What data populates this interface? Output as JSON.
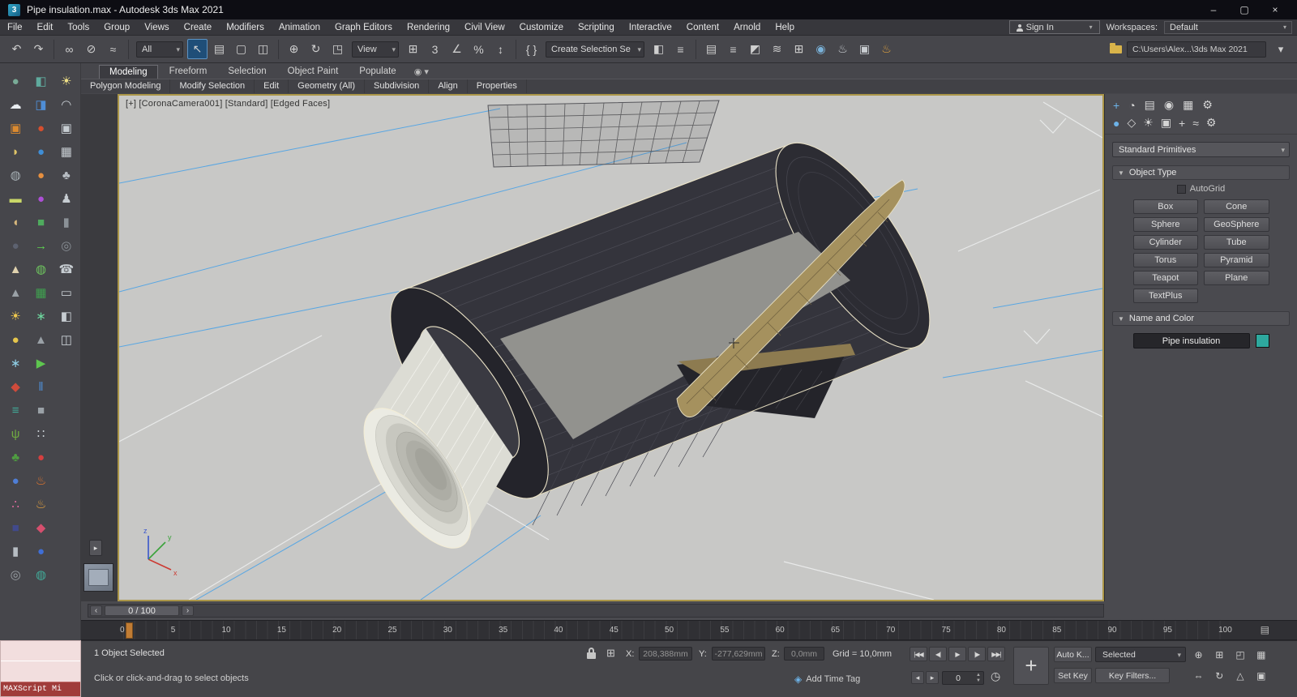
{
  "colors": {
    "object_color": "#2ea89e",
    "ruler_handle": "#c07c34",
    "viewport_bg": "#c8c8c6",
    "selection_outline": "#ece4c8"
  },
  "titlebar": {
    "logo": "3",
    "title": "Pipe insulation.max - Autodesk 3ds Max 2021",
    "minimize": "–",
    "maximize": "▢",
    "close": "×"
  },
  "menubar": {
    "items": [
      "File",
      "Edit",
      "Tools",
      "Group",
      "Views",
      "Create",
      "Modifiers",
      "Animation",
      "Graph Editors",
      "Rendering",
      "Civil View",
      "Customize",
      "Scripting",
      "Interactive",
      "Content",
      "Arnold",
      "Help"
    ],
    "signin": "Sign In",
    "workspaces_label": "Workspaces:",
    "workspace": "Default"
  },
  "toolbar": {
    "items": [
      {
        "cls": "tb-icon",
        "n": "undo-icon",
        "g": "↶"
      },
      {
        "cls": "tb-icon",
        "n": "redo-icon",
        "g": "↷"
      },
      {
        "cls": "tb-sep",
        "n": "toolbar-separator",
        "g": ""
      },
      {
        "cls": "tb-icon",
        "n": "select-link-icon",
        "g": "∞"
      },
      {
        "cls": "tb-icon",
        "n": "unlink-icon",
        "g": "⊘"
      },
      {
        "cls": "tb-icon",
        "n": "bind-spacewarp-icon",
        "g": "≈"
      },
      {
        "cls": "tb-sep",
        "n": "toolbar-separator",
        "g": ""
      },
      {
        "cls": "tb-dd",
        "n": "selection-filter-dropdown",
        "g": "All"
      },
      {
        "cls": "tb-icon active",
        "n": "select-object-icon",
        "g": "↖"
      },
      {
        "cls": "tb-icon",
        "n": "select-by-name-icon",
        "g": "▤"
      },
      {
        "cls": "tb-icon",
        "n": "rect-selection-icon",
        "g": "▢"
      },
      {
        "cls": "tb-icon",
        "n": "window-crossing-icon",
        "g": "◫"
      },
      {
        "cls": "tb-sep",
        "n": "toolbar-separator",
        "g": ""
      },
      {
        "cls": "tb-icon",
        "n": "select-move-icon",
        "g": "⊕"
      },
      {
        "cls": "tb-icon",
        "n": "select-rotate-icon",
        "g": "↻"
      },
      {
        "cls": "tb-icon",
        "n": "select-scale-icon",
        "g": "◳"
      },
      {
        "cls": "tb-dd",
        "n": "ref-coord-dropdown",
        "g": "View"
      },
      {
        "cls": "tb-icon",
        "n": "use-pivot-center-icon",
        "g": "⊞"
      },
      {
        "cls": "tb-icon",
        "n": "snap-3d-icon",
        "g": "3"
      },
      {
        "cls": "tb-icon",
        "n": "angle-snap-icon",
        "g": "∠"
      },
      {
        "cls": "tb-icon",
        "n": "percent-snap-icon",
        "g": "%"
      },
      {
        "cls": "tb-icon",
        "n": "spinner-snap-icon",
        "g": "↕"
      },
      {
        "cls": "tb-sep",
        "n": "toolbar-separator",
        "g": ""
      },
      {
        "cls": "tb-icon",
        "n": "edit-named-selection-icon",
        "g": "{ }"
      },
      {
        "cls": "tb-dd tb-dd-wide",
        "n": "named-selection-dropdown",
        "g": "Create Selection Se"
      },
      {
        "cls": "tb-icon",
        "n": "mirror-icon",
        "g": "◧"
      },
      {
        "cls": "tb-icon",
        "n": "align-icon",
        "g": "≡"
      },
      {
        "cls": "tb-sep",
        "n": "toolbar-separator",
        "g": ""
      },
      {
        "cls": "tb-icon",
        "n": "scene-explorer-icon",
        "g": "▤"
      },
      {
        "cls": "tb-icon",
        "n": "layer-manager-icon",
        "g": "≡"
      },
      {
        "cls": "tb-icon",
        "n": "ribbon-toggle-icon",
        "g": "◩"
      },
      {
        "cls": "tb-icon",
        "n": "curve-editor-icon",
        "g": "≋"
      },
      {
        "cls": "tb-icon",
        "n": "schematic-view-icon",
        "g": "⊞"
      },
      {
        "cls": "tb-icon",
        "n": "material-editor-icon",
        "g": "◉",
        "c": "#7ab2d9"
      },
      {
        "cls": "tb-icon",
        "n": "render-setup-icon",
        "g": "♨",
        "c": "#c9cdd1"
      },
      {
        "cls": "tb-icon",
        "n": "rendered-frame-icon",
        "g": "▣",
        "c": "#c9cdd1"
      },
      {
        "cls": "tb-icon",
        "n": "render-production-icon",
        "g": "♨",
        "c": "#e0a23f"
      }
    ],
    "path": "C:\\Users\\Alex...\\3ds Max 2021",
    "path_extra": "▾"
  },
  "ribbon": {
    "tabs": [
      {
        "label": "Modeling",
        "cls": "active"
      },
      {
        "label": "Freeform"
      },
      {
        "label": "Selection"
      },
      {
        "label": "Object Paint"
      },
      {
        "label": "Populate"
      }
    ],
    "extra": "◉ ▾",
    "groups": [
      "Polygon Modeling",
      "Modify Selection",
      "Edit",
      "Geometry (All)",
      "Subdivision",
      "Align",
      "Properties"
    ]
  },
  "left_tools": {
    "col1": [
      {
        "n": "sphere-tool-icon",
        "g": "●",
        "c": "#79ab97"
      },
      {
        "n": "cloud-tool-icon",
        "g": "☁",
        "c": "#e9edf1"
      },
      {
        "n": "image-frame-icon",
        "g": "▣",
        "c": "#db8a2f"
      },
      {
        "n": "putty-tool-icon",
        "g": "◗",
        "c": "#dfc468"
      },
      {
        "n": "spray-tool-icon",
        "g": "◍",
        "c": "#a7b0b5"
      },
      {
        "n": "plane-tool-icon",
        "g": "▬",
        "c": "#c9d768"
      },
      {
        "n": "bun-tool-icon",
        "g": "◖",
        "c": "#d7b77c"
      },
      {
        "n": "dark-sphere-icon",
        "g": "●",
        "c": "#5d6270"
      },
      {
        "n": "cake-tool-icon",
        "g": "▲",
        "c": "#e0d2ae"
      },
      {
        "n": "cone-tool-icon",
        "g": "▲",
        "c": "#9aa1a7"
      },
      {
        "n": "sun-icon",
        "g": "☀",
        "c": "#f0c94e"
      },
      {
        "n": "yellow-sphere-icon",
        "g": "●",
        "c": "#e6c64c"
      },
      {
        "n": "snowflake-icon",
        "g": "∗",
        "c": "#8fcfe6"
      },
      {
        "n": "droplet-icon",
        "g": "◆",
        "c": "#cf4b3b"
      },
      {
        "n": "ladder-icon",
        "g": "≡",
        "c": "#41ab99"
      },
      {
        "n": "grass-icon",
        "g": "ψ",
        "c": "#70ab41"
      },
      {
        "n": "foliage-icon",
        "g": "♣",
        "c": "#4f9c41"
      },
      {
        "n": "blue-sphere-icon",
        "g": "●",
        "c": "#4f7ed6"
      },
      {
        "n": "berries-icon",
        "g": "∴",
        "c": "#df6a9e"
      },
      {
        "n": "box-tool-icon",
        "g": "■",
        "c": "#414a8c"
      },
      {
        "n": "cylinder-tool-icon",
        "g": "▮",
        "c": "#b7bdc3"
      },
      {
        "n": "spiral-tool-icon",
        "g": "◎",
        "c": "#9aa0a5"
      }
    ],
    "col2": [
      {
        "n": "cube-teal-icon",
        "g": "◧",
        "c": "#5fab9e"
      },
      {
        "n": "cube-blue-icon",
        "g": "◨",
        "c": "#4f8ed6"
      },
      {
        "n": "fire-sphere-icon",
        "g": "●",
        "c": "#d64f2e"
      },
      {
        "n": "water-sphere-icon",
        "g": "●",
        "c": "#3f8ed6"
      },
      {
        "n": "orange-sphere-icon",
        "g": "●",
        "c": "#e68f3f"
      },
      {
        "n": "purple-sphere-icon",
        "g": "●",
        "c": "#ad4fd6"
      },
      {
        "n": "green-cube-icon",
        "g": "■",
        "c": "#4fab5e"
      },
      {
        "n": "arrow-tool-icon",
        "g": "→",
        "c": "#5ed64f"
      },
      {
        "n": "pattern-sphere-icon",
        "g": "◍",
        "c": "#6ec65e"
      },
      {
        "n": "checker-tool-icon",
        "g": "▦",
        "c": "#3fa14f"
      },
      {
        "n": "starburst-icon",
        "g": "∗",
        "c": "#6ed69e"
      },
      {
        "n": "gray-cone-icon",
        "g": "▲",
        "c": "#9aa1a7"
      },
      {
        "n": "play-shape-icon",
        "g": "▶",
        "c": "#5ec64f"
      },
      {
        "n": "pause-shape-icon",
        "g": "‖",
        "c": "#4f8ed6"
      },
      {
        "n": "stop-shape-icon",
        "g": "■",
        "c": "#9aa1a7"
      },
      {
        "n": "dots-tool-icon",
        "g": "∷",
        "c": "#c6ccd1"
      },
      {
        "n": "red-sphere-icon",
        "g": "●",
        "c": "#d63f3f"
      },
      {
        "n": "flame-icon",
        "g": "♨",
        "c": "#e6772e"
      },
      {
        "n": "torch-icon",
        "g": "♨",
        "c": "#e6a13f"
      },
      {
        "n": "paint-icon",
        "g": "◆",
        "c": "#d64f6e"
      },
      {
        "n": "ocean-sphere-icon",
        "g": "●",
        "c": "#3f6ed6"
      },
      {
        "n": "globe-icon",
        "g": "◍",
        "c": "#41ab99"
      }
    ],
    "col3": [
      {
        "n": "lightbulb-icon",
        "g": "☀",
        "c": "#efe087"
      },
      {
        "n": "dome-icon",
        "g": "◠",
        "c": "#c6ccd1"
      },
      {
        "n": "camera-icon",
        "g": "▣",
        "c": "#c6ccd1"
      },
      {
        "n": "photo-icon",
        "g": "▦",
        "c": "#c6ccd1"
      },
      {
        "n": "tree-icon",
        "g": "♣",
        "c": "#b7bdc3"
      },
      {
        "n": "person-icon",
        "g": "♟",
        "c": "#c6ccd1"
      },
      {
        "n": "cylinder-icon",
        "g": "▮",
        "c": "#8b9197"
      },
      {
        "n": "torus-icon",
        "g": "◎",
        "c": "#8b9197"
      },
      {
        "n": "phone-icon",
        "g": "☎",
        "c": "#c6ccd1"
      },
      {
        "n": "monitor-icon",
        "g": "▭",
        "c": "#c6ccd1"
      },
      {
        "n": "camcorder-icon",
        "g": "◧",
        "c": "#c6ccd1"
      },
      {
        "n": "split-view-icon",
        "g": "◫",
        "c": "#c6ccd1"
      }
    ],
    "flyout_arrow": "▸"
  },
  "viewport": {
    "label": "[+] [CoronaCamera001] [Standard] [Edged Faces]"
  },
  "right_panel": {
    "panel_tabs": [
      {
        "n": "create-tab-icon",
        "g": "+",
        "cls": "active"
      },
      {
        "n": "modify-tab-icon",
        "g": "◔"
      },
      {
        "n": "hierarchy-tab-icon",
        "g": "▤"
      },
      {
        "n": "motion-tab-icon",
        "g": "◉"
      },
      {
        "n": "display-tab-icon",
        "g": "▦"
      },
      {
        "n": "utilities-tab-icon",
        "g": "⚙"
      }
    ],
    "categories": [
      {
        "n": "geometry-category-icon",
        "g": "●",
        "cls": "active"
      },
      {
        "n": "shapes-category-icon",
        "g": "◇"
      },
      {
        "n": "lights-category-icon",
        "g": "☀"
      },
      {
        "n": "cameras-category-icon",
        "g": "▣"
      },
      {
        "n": "helpers-category-icon",
        "g": "+"
      },
      {
        "n": "spacewarps-category-icon",
        "g": "≈"
      },
      {
        "n": "systems-category-icon",
        "g": "⚙"
      }
    ],
    "dropdown": "Standard Primitives",
    "rollout_object_type": "Object Type",
    "autogrid": "AutoGrid",
    "buttons": [
      "Box",
      "Cone",
      "Sphere",
      "GeoSphere",
      "Cylinder",
      "Tube",
      "Torus",
      "Pyramid",
      "Teapot",
      "Plane",
      "TextPlus"
    ],
    "rollout_name_color": "Name and Color",
    "object_name": "Pipe insulation",
    "object_color": "#2ea89e"
  },
  "timeline": {
    "prev": "‹",
    "range": "0 / 100",
    "next": "›"
  },
  "ruler": {
    "numbers": [
      "0",
      "5",
      "10",
      "15",
      "20",
      "25",
      "30",
      "35",
      "40",
      "45",
      "50",
      "55",
      "60",
      "65",
      "70",
      "75",
      "80",
      "85",
      "90",
      "95",
      "100"
    ],
    "end_icon": "▤"
  },
  "statusbar": {
    "selected_info": "1 Object Selected",
    "prompt": "Click or click-and-drag to select objects",
    "abs_toggle": "⊞",
    "x_label": "X:",
    "x_value": "208,388mm",
    "y_label": "Y:",
    "y_value": "-277,629mm",
    "z_label": "Z:",
    "z_value": "0,0mm",
    "grid": "Grid = 10,0mm",
    "timetag_icon": "◈",
    "add_time_tag": "Add Time Tag",
    "playback": [
      {
        "n": "go-to-start-button",
        "g": "|◀◀"
      },
      {
        "n": "previous-frame-button",
        "g": "◀|"
      },
      {
        "n": "play-button",
        "g": "▶"
      },
      {
        "n": "next-frame-button",
        "g": "|▶"
      },
      {
        "n": "go-to-end-button",
        "g": "▶▶|"
      }
    ],
    "step_back": "◂",
    "step_fwd": "▸",
    "frame": "0",
    "spin_up": "▲",
    "spin_down": "▼",
    "clock_icon": "◷",
    "big_key": "+",
    "auto_key": "Auto K...",
    "selected_dd": "Selected",
    "set_key": "Set Key",
    "key_filters": "Key Filters...",
    "nav_icons": [
      {
        "n": "zoom-icon",
        "g": "⊕"
      },
      {
        "n": "zoom-all-icon",
        "g": "⊞"
      },
      {
        "n": "zoom-extents-icon",
        "g": "◰"
      },
      {
        "n": "zoom-extents-all-icon",
        "g": "▦"
      },
      {
        "n": "pan-icon",
        "g": "⇔"
      },
      {
        "n": "orbit-icon",
        "g": "↻"
      },
      {
        "n": "field-of-view-icon",
        "g": "△"
      },
      {
        "n": "maximize-viewport-toggle-icon",
        "g": "▣"
      }
    ]
  },
  "maxscript": {
    "label": "MAXScript Mi"
  }
}
